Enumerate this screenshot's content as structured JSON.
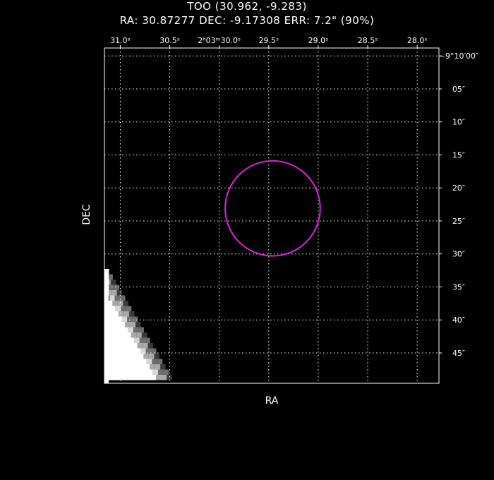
{
  "chart_data": {
    "type": "scatter",
    "title": "TOO (30.962, -9.283)",
    "subtitle": "RA: 30.87277  DEC: -9.17308  ERR: 7.2\" (90%)",
    "xlabel": "RA",
    "ylabel": "DEC",
    "x_ticks": [
      {
        "value": 31.0,
        "label": "31.0ˢ"
      },
      {
        "value": 30.5,
        "label": "30.5ˢ"
      },
      {
        "value": 30.0,
        "label": "2ʰ03ᵐ30.0ˢ"
      },
      {
        "value": 29.5,
        "label": "29.5ˢ"
      },
      {
        "value": 29.0,
        "label": "29.0ˢ"
      },
      {
        "value": 28.5,
        "label": "28.5ˢ"
      },
      {
        "value": 28.0,
        "label": "28.0ˢ"
      }
    ],
    "y_ticks": [
      {
        "value": 0,
        "label": "−9°10′00″"
      },
      {
        "value": 5,
        "label": "05″"
      },
      {
        "value": 10,
        "label": "10″"
      },
      {
        "value": 15,
        "label": "15″"
      },
      {
        "value": 20,
        "label": "20″"
      },
      {
        "value": 25,
        "label": "25″"
      },
      {
        "value": 30,
        "label": "30″"
      },
      {
        "value": 35,
        "label": "35″"
      },
      {
        "value": 40,
        "label": "40″"
      },
      {
        "value": 45,
        "label": "45″"
      }
    ],
    "xlim": [
      31.16,
      27.78
    ],
    "ylim": [
      -1.2,
      49.6
    ],
    "error_circle": {
      "ra_sec": 29.46,
      "dec_arcsec": 23.1,
      "radius_arcsec": 7.2,
      "color": "#e020e0"
    },
    "grid": true,
    "grid_color": "#ffffff",
    "frame_color": "#ffffff",
    "background": "#000000"
  }
}
